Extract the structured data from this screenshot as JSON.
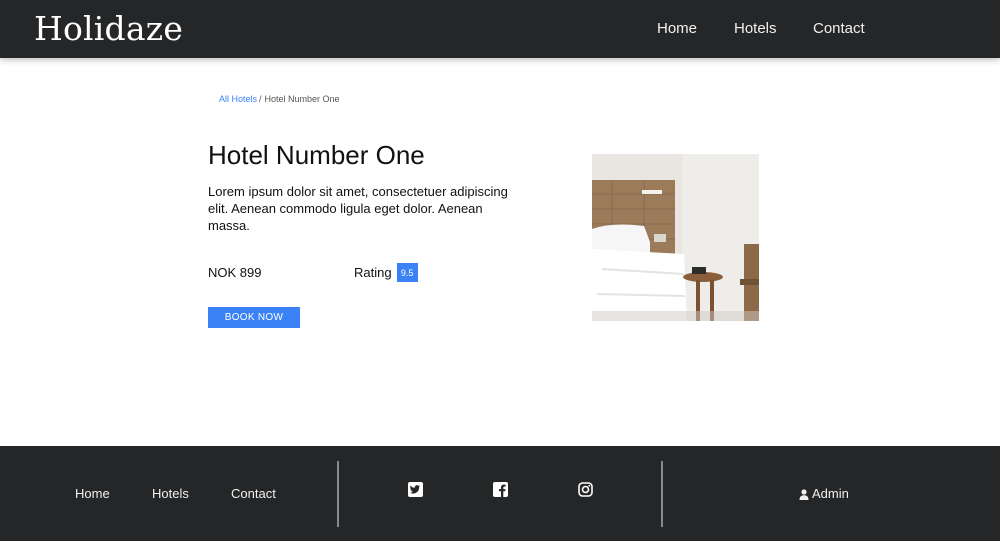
{
  "header": {
    "brand": "Holidaze",
    "nav": [
      "Home",
      "Hotels",
      "Contact"
    ]
  },
  "breadcrumb": {
    "parent": "All Hotels",
    "separator": "/",
    "current": "Hotel Number One"
  },
  "hotel": {
    "name": "Hotel Number One",
    "description": "Lorem ipsum dolor sit amet, consectetuer adipiscing elit. Aenean commodo ligula eget dolor. Aenean massa.",
    "price": "NOK 899",
    "rating_label": "Rating",
    "rating_value": "9.5",
    "book_label": "BOOK NOW"
  },
  "footer": {
    "links": [
      "Home",
      "Hotels",
      "Contact"
    ],
    "social_icons": [
      "twitter-icon",
      "facebook-icon",
      "instagram-icon"
    ],
    "admin_icon": "user-icon",
    "admin_label": "Admin"
  },
  "colors": {
    "header_bg": "#252628",
    "accent": "#3b82f6",
    "footer_bg": "#252628"
  }
}
